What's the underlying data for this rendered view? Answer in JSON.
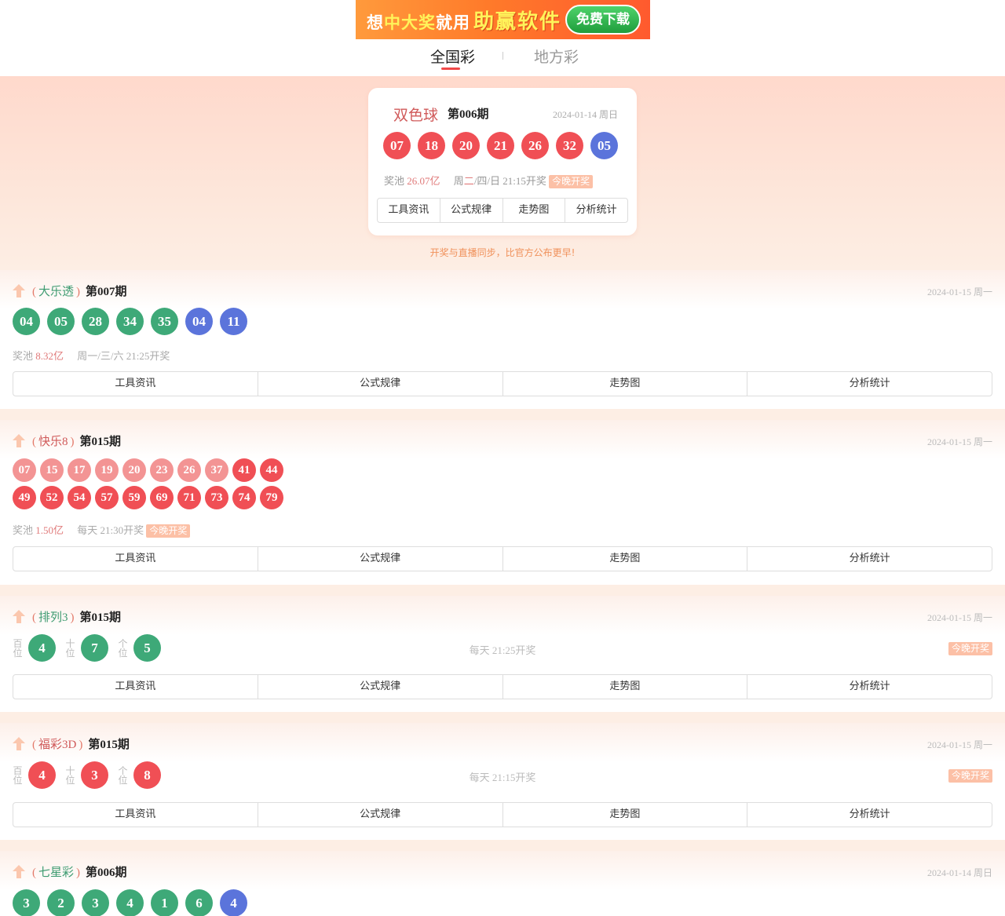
{
  "banner": {
    "text_part1": "想",
    "text_hl": "中大奖",
    "text_part2": "就用",
    "text_big": "助赢软件",
    "button": "免费下载"
  },
  "nav": {
    "tab_national": "全国彩",
    "tab_local": "地方彩"
  },
  "hero": {
    "name": "双色球",
    "issue": "第006期",
    "date": "2024-01-14 周日",
    "balls": [
      {
        "n": "07",
        "c": "red"
      },
      {
        "n": "18",
        "c": "red"
      },
      {
        "n": "20",
        "c": "red"
      },
      {
        "n": "21",
        "c": "red"
      },
      {
        "n": "26",
        "c": "red"
      },
      {
        "n": "32",
        "c": "red"
      },
      {
        "n": "05",
        "c": "blue"
      }
    ],
    "pool_label": "奖池",
    "pool_value": "26.07亿",
    "schedule_pre": "周",
    "schedule_days": "二",
    "schedule_post": "/四/日 21:15开奖",
    "tonight": "今晚开奖",
    "links": [
      "工具资讯",
      "公式规律",
      "走势图",
      "分析统计"
    ],
    "slogan": "开奖与直播同步，比官方公布更早!"
  },
  "dlt": {
    "name": "大乐透",
    "issue": "第007期",
    "date": "2024-01-15 周一",
    "balls": [
      {
        "n": "04",
        "c": "green"
      },
      {
        "n": "05",
        "c": "green"
      },
      {
        "n": "28",
        "c": "green"
      },
      {
        "n": "34",
        "c": "green"
      },
      {
        "n": "35",
        "c": "green"
      },
      {
        "n": "04",
        "c": "blue"
      },
      {
        "n": "11",
        "c": "blue"
      }
    ],
    "pool_label": "奖池",
    "pool_value": "8.32亿",
    "schedule": "周一/三/六 21:25开奖",
    "links": [
      "工具资讯",
      "公式规律",
      "走势图",
      "分析统计"
    ]
  },
  "kl8": {
    "name": "快乐8",
    "issue": "第015期",
    "date": "2024-01-15 周一",
    "row1": [
      {
        "n": "07",
        "c": "pink"
      },
      {
        "n": "15",
        "c": "pink"
      },
      {
        "n": "17",
        "c": "pink"
      },
      {
        "n": "19",
        "c": "pink"
      },
      {
        "n": "20",
        "c": "pink"
      },
      {
        "n": "23",
        "c": "pink"
      },
      {
        "n": "26",
        "c": "pink"
      },
      {
        "n": "37",
        "c": "pink"
      },
      {
        "n": "41",
        "c": "red"
      },
      {
        "n": "44",
        "c": "red"
      }
    ],
    "row2": [
      {
        "n": "49",
        "c": "red"
      },
      {
        "n": "52",
        "c": "red"
      },
      {
        "n": "54",
        "c": "red"
      },
      {
        "n": "57",
        "c": "red"
      },
      {
        "n": "59",
        "c": "red"
      },
      {
        "n": "69",
        "c": "red"
      },
      {
        "n": "71",
        "c": "red"
      },
      {
        "n": "73",
        "c": "red"
      },
      {
        "n": "74",
        "c": "red"
      },
      {
        "n": "79",
        "c": "red"
      }
    ],
    "pool_label": "奖池",
    "pool_value": "1.50亿",
    "schedule": "每天 21:30开奖",
    "tonight": "今晚开奖",
    "links": [
      "工具资讯",
      "公式规律",
      "走势图",
      "分析统计"
    ]
  },
  "pl3": {
    "name": "排列3",
    "issue": "第015期",
    "date": "2024-01-15 周一",
    "positions": [
      {
        "label": "百位",
        "n": "4"
      },
      {
        "label": "十位",
        "n": "7"
      },
      {
        "label": "个位",
        "n": "5"
      }
    ],
    "schedule": "每天 21:25开奖",
    "tonight": "今晚开奖",
    "links": [
      "工具资讯",
      "公式规律",
      "走势图",
      "分析统计"
    ]
  },
  "fc3d": {
    "name": "福彩3D",
    "issue": "第015期",
    "date": "2024-01-15 周一",
    "positions": [
      {
        "label": "百位",
        "n": "4"
      },
      {
        "label": "十位",
        "n": "3"
      },
      {
        "label": "个位",
        "n": "8"
      }
    ],
    "schedule": "每天 21:15开奖",
    "tonight": "今晚开奖",
    "links": [
      "工具资讯",
      "公式规律",
      "走势图",
      "分析统计"
    ]
  },
  "qxc": {
    "name": "七星彩",
    "issue": "第006期",
    "date": "2024-01-14 周日",
    "balls": [
      {
        "n": "3",
        "c": "green"
      },
      {
        "n": "2",
        "c": "green"
      },
      {
        "n": "3",
        "c": "green"
      },
      {
        "n": "4",
        "c": "green"
      },
      {
        "n": "1",
        "c": "green"
      },
      {
        "n": "6",
        "c": "green"
      },
      {
        "n": "4",
        "c": "blue"
      }
    ]
  },
  "colors": {
    "red_ball": "#f04f55",
    "blue_ball": "#5b74db",
    "green_ball": "#3ea978",
    "pink_ball": "#f39494",
    "accent": "#f04848"
  }
}
